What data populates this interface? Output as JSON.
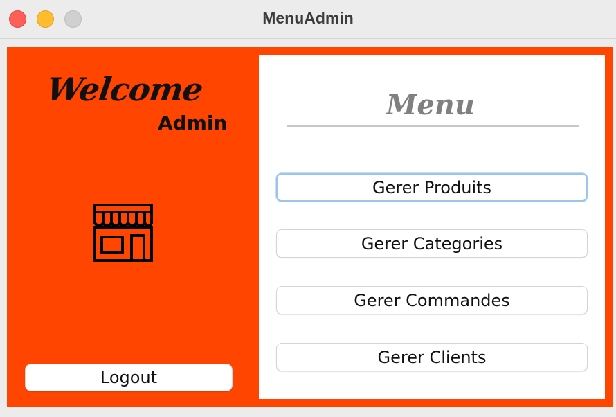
{
  "window": {
    "title": "MenuAdmin"
  },
  "sidebar": {
    "welcome": "Welcome",
    "role": "Admin",
    "icon": "store-icon",
    "logout_label": "Logout",
    "background_color": "#ff4500"
  },
  "menu": {
    "title": "Menu",
    "items": [
      {
        "label": "Gerer Produits",
        "focused": true
      },
      {
        "label": "Gerer Categories",
        "focused": false
      },
      {
        "label": "Gerer Commandes",
        "focused": false
      },
      {
        "label": "Gerer Clients",
        "focused": false
      }
    ]
  }
}
